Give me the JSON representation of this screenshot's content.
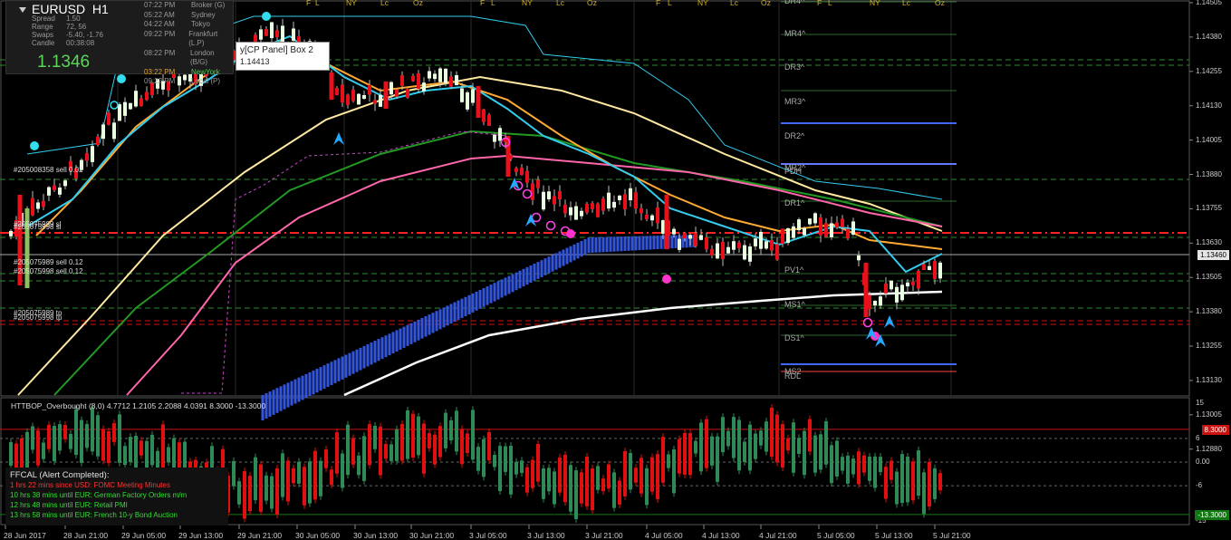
{
  "symbol": "EURUSD",
  "timeframe": "H1",
  "info": {
    "rows": [
      {
        "k": "Spread",
        "v": "1.50"
      },
      {
        "k": "Range",
        "v": "72, 56"
      },
      {
        "k": "Swaps",
        "v": "-5.40, -1.76"
      },
      {
        "k": "Candle",
        "v": "00:38:08"
      }
    ],
    "price": "1.1346"
  },
  "sessions": [
    {
      "t": "07:22 PM",
      "n": "Broker (G)"
    },
    {
      "t": "05:22 AM",
      "n": "Sydney"
    },
    {
      "t": "04:22 AM",
      "n": "Tokyo"
    },
    {
      "t": "09:22 PM",
      "n": "Frankfurt (L.P)"
    },
    {
      "t": "08:22 PM",
      "n": "London (B/G)"
    },
    {
      "t": "03:22 PM",
      "n": "NewYork"
    },
    {
      "t": "09:22 PM",
      "n": "Local (P)"
    }
  ],
  "tooltip": {
    "title": "y[CP Panel] Box 2",
    "value": "1.14413"
  },
  "price_axis": [
    "1.14505",
    "1.14380",
    "1.14255",
    "1.14130",
    "1.14005",
    "1.13880",
    "1.13755",
    "1.13630",
    "1.13505",
    "1.13380",
    "1.13255",
    "1.13130",
    "1.13005",
    "1.12880"
  ],
  "current_price_tag": "1.13460",
  "levels": [
    {
      "name": "DR4",
      "label": "DR4^"
    },
    {
      "name": "MR4",
      "label": "MR4^"
    },
    {
      "name": "DR3",
      "label": "DR3^"
    },
    {
      "name": "MR3",
      "label": "MR3^"
    },
    {
      "name": "DR2",
      "label": "DR2^"
    },
    {
      "name": "MR2",
      "label": "MR2^"
    },
    {
      "name": "PDH",
      "label": "PDH"
    },
    {
      "name": "DR1",
      "label": "DR1^"
    },
    {
      "name": "PV1",
      "label": "PV1^"
    },
    {
      "name": "MS1",
      "label": "MS1^"
    },
    {
      "name": "DS1",
      "label": "DS1^"
    },
    {
      "name": "MS2",
      "label": "MS2"
    },
    {
      "name": "RDL",
      "label": "RDL"
    }
  ],
  "session_markers": [
    "F",
    "L",
    "NY",
    "Lc",
    "Oz"
  ],
  "order_labels": [
    "#205008358 sell 0.02",
    "#205075989 sl",
    "#205075998 sl",
    "#205075989 sell 0.12",
    "#205075998 sell 0.12",
    "#205075989 tp",
    "#205075998 tp"
  ],
  "indicator": {
    "label": "HTTBOP_Overbought (8,0) 4.7712 1.2105 2.2088 4.0391 8.3000 -13.3000",
    "axis": [
      "15",
      "6",
      "0.00",
      "-6",
      "-15"
    ],
    "upper_tag": "8.3000",
    "lower_tag": "-13.3000"
  },
  "ffcal": {
    "title": "FFCAL  (Alert Completed):",
    "lines": [
      {
        "text": "1 hrs 22 mins since USD: FOMC Meeting Minutes",
        "color": "red"
      },
      {
        "text": "10 hrs 38 mins until EUR: German Factory Orders m/m",
        "color": "green"
      },
      {
        "text": "12 hrs 48 mins until EUR: Retail PMI",
        "color": "green"
      },
      {
        "text": "13 hrs 58 mins until EUR: French 10-y Bond Auction",
        "color": "green"
      }
    ]
  },
  "time_axis": [
    "28 Jun 2017",
    "28 Jun 21:00",
    "29 Jun 05:00",
    "29 Jun 13:00",
    "29 Jun 21:00",
    "30 Jun 05:00",
    "30 Jun 13:00",
    "30 Jun 21:00",
    "3 Jul 05:00",
    "3 Jul 13:00",
    "3 Jul 21:00",
    "4 Jul 05:00",
    "4 Jul 13:00",
    "4 Jul 21:00",
    "5 Jul 05:00",
    "5 Jul 13:00",
    "5 Jul 21:00"
  ],
  "colors": {
    "bull": "#e8ffe0",
    "bear": "#e8101a",
    "ind_up": "#2e8b57",
    "ind_down": "#e01010",
    "bg": "#000000"
  }
}
